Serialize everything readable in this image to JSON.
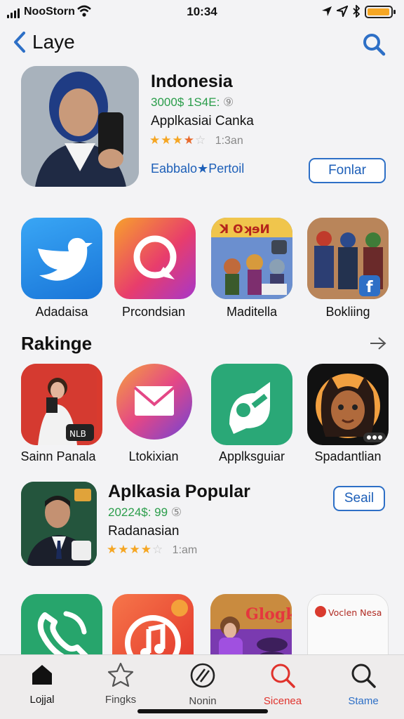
{
  "status_bar": {
    "carrier": "NooStorn",
    "time": "10:34"
  },
  "nav": {
    "title": "Laye"
  },
  "featured": {
    "title": "Indonesia",
    "price": "3000$ 1S4E:",
    "price_suffix": "⑨",
    "subtitle": "Applkasiai Canka",
    "rating": 3.5,
    "rating_count": "1:3an",
    "link_text": "Eabbalo★Pertoil",
    "button_label": "Fonlar"
  },
  "top_apps": [
    {
      "label": "Adadaisa",
      "icon": "bird-icon"
    },
    {
      "label": "Prcondsian",
      "icon": "chat-bubble-icon"
    },
    {
      "label": "Maditella",
      "icon": "game-art-icon",
      "art_text": "ꓘ ʘʞɘИ"
    },
    {
      "label": "Bokliing",
      "icon": "heroes-art-icon"
    }
  ],
  "ranking": {
    "title": "Rakinge",
    "apps": [
      {
        "label": "Sainn Panala",
        "icon": "photo-person-icon",
        "badge": "NLB"
      },
      {
        "label": "Ltokixian",
        "icon": "mail-icon"
      },
      {
        "label": "Applksguiar",
        "icon": "swirl-logo-icon"
      },
      {
        "label": "Spadantlian",
        "icon": "avatar-art-icon"
      }
    ]
  },
  "popular": {
    "title": "Aplkasia Popular",
    "price": "20224$: 99",
    "price_suffix": "⑤",
    "subtitle": "Radanasian",
    "rating": 4.5,
    "rating_count": "1:am",
    "button_label": "Seail"
  },
  "bottom_apps": [
    {
      "label": "",
      "icon": "phone-icon"
    },
    {
      "label": "",
      "icon": "music-note-icon"
    },
    {
      "label": "",
      "icon": "game-art-icon",
      "art_text": "Glogk"
    },
    {
      "label": "",
      "icon": "news-card-icon",
      "art_text": "Voclen Nesa"
    }
  ],
  "tab_bar": {
    "tabs": [
      {
        "label": "Lojjal",
        "icon": "home-icon"
      },
      {
        "label": "Fingks",
        "icon": "star-icon"
      },
      {
        "label": "Nonin",
        "icon": "slash-circle-icon"
      },
      {
        "label": "Sicenea",
        "icon": "search-icon"
      },
      {
        "label": "Stame",
        "icon": "search-icon"
      }
    ]
  },
  "colors": {
    "accent_blue": "#2d6fc6",
    "price_green": "#2a9d4a",
    "star_orange": "#f5a623",
    "active_red": "#e0322c"
  }
}
